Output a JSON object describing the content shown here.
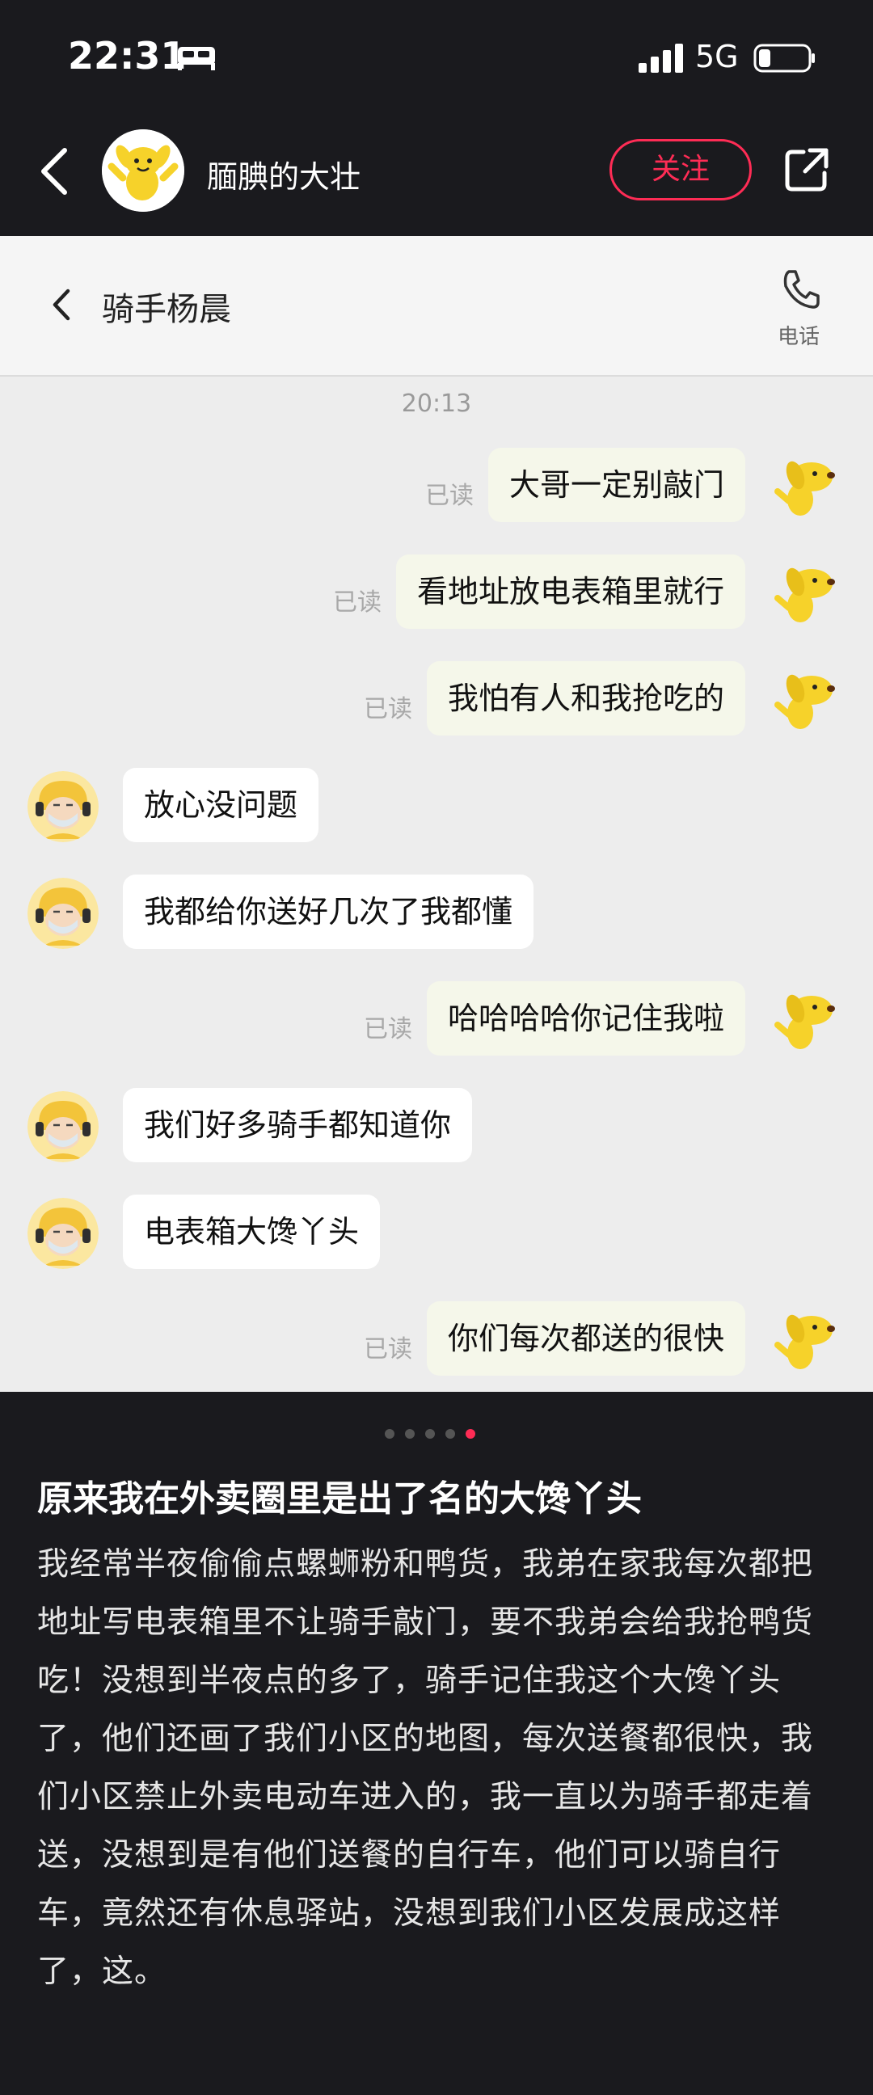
{
  "status_bar": {
    "time": "22:31",
    "network": "5G"
  },
  "header": {
    "name": "腼腆的大壮",
    "follow_label": "关注"
  },
  "chat": {
    "contact_name": "骑手杨晨",
    "call_label": "电话",
    "timestamp": "20:13",
    "read_label": "已读",
    "messages": [
      {
        "side": "right",
        "text": "大哥一定别敲门",
        "read": "已读"
      },
      {
        "side": "right",
        "text": "看地址放电表箱里就行",
        "read": "已读"
      },
      {
        "side": "right",
        "text": "我怕有人和我抢吃的",
        "read": "已读"
      },
      {
        "side": "left",
        "text": "放心没问题"
      },
      {
        "side": "left",
        "text": "我都给你送好几次了我都懂"
      },
      {
        "side": "right",
        "text": "哈哈哈哈你记住我啦",
        "read": "已读"
      },
      {
        "side": "left",
        "text": "我们好多骑手都知道你"
      },
      {
        "side": "left",
        "text": "电表箱大馋丫头"
      },
      {
        "side": "right",
        "text": "你们每次都送的很快",
        "read": "已读"
      }
    ]
  },
  "carousel": {
    "total": 5,
    "active": 5,
    "active_color": "#fe2c55"
  },
  "post": {
    "title": "原来我在外卖圈里是出了名的大馋丫头",
    "body": "我经常半夜偷偷点螺蛳粉和鸭货，我弟在家我每次都把地址写电表箱里不让骑手敲门，要不我弟会给我抢鸭货吃！没想到半夜点的多了，骑手记住我这个大馋丫头了，他们还画了我们小区的地图，每次送餐都很快，我们小区禁止外卖电动车进入的，我一直以为骑手都走着送，没想到是有他们送餐的自行车，他们可以骑自行车，竟然还有休息驿站，没想到我们小区发展成这样了，这",
    "tail": "。"
  },
  "colors": {
    "accent": "#fe2c55",
    "bubble_right": "#f5f7ea",
    "dog_yellow": "#f6d22a"
  }
}
